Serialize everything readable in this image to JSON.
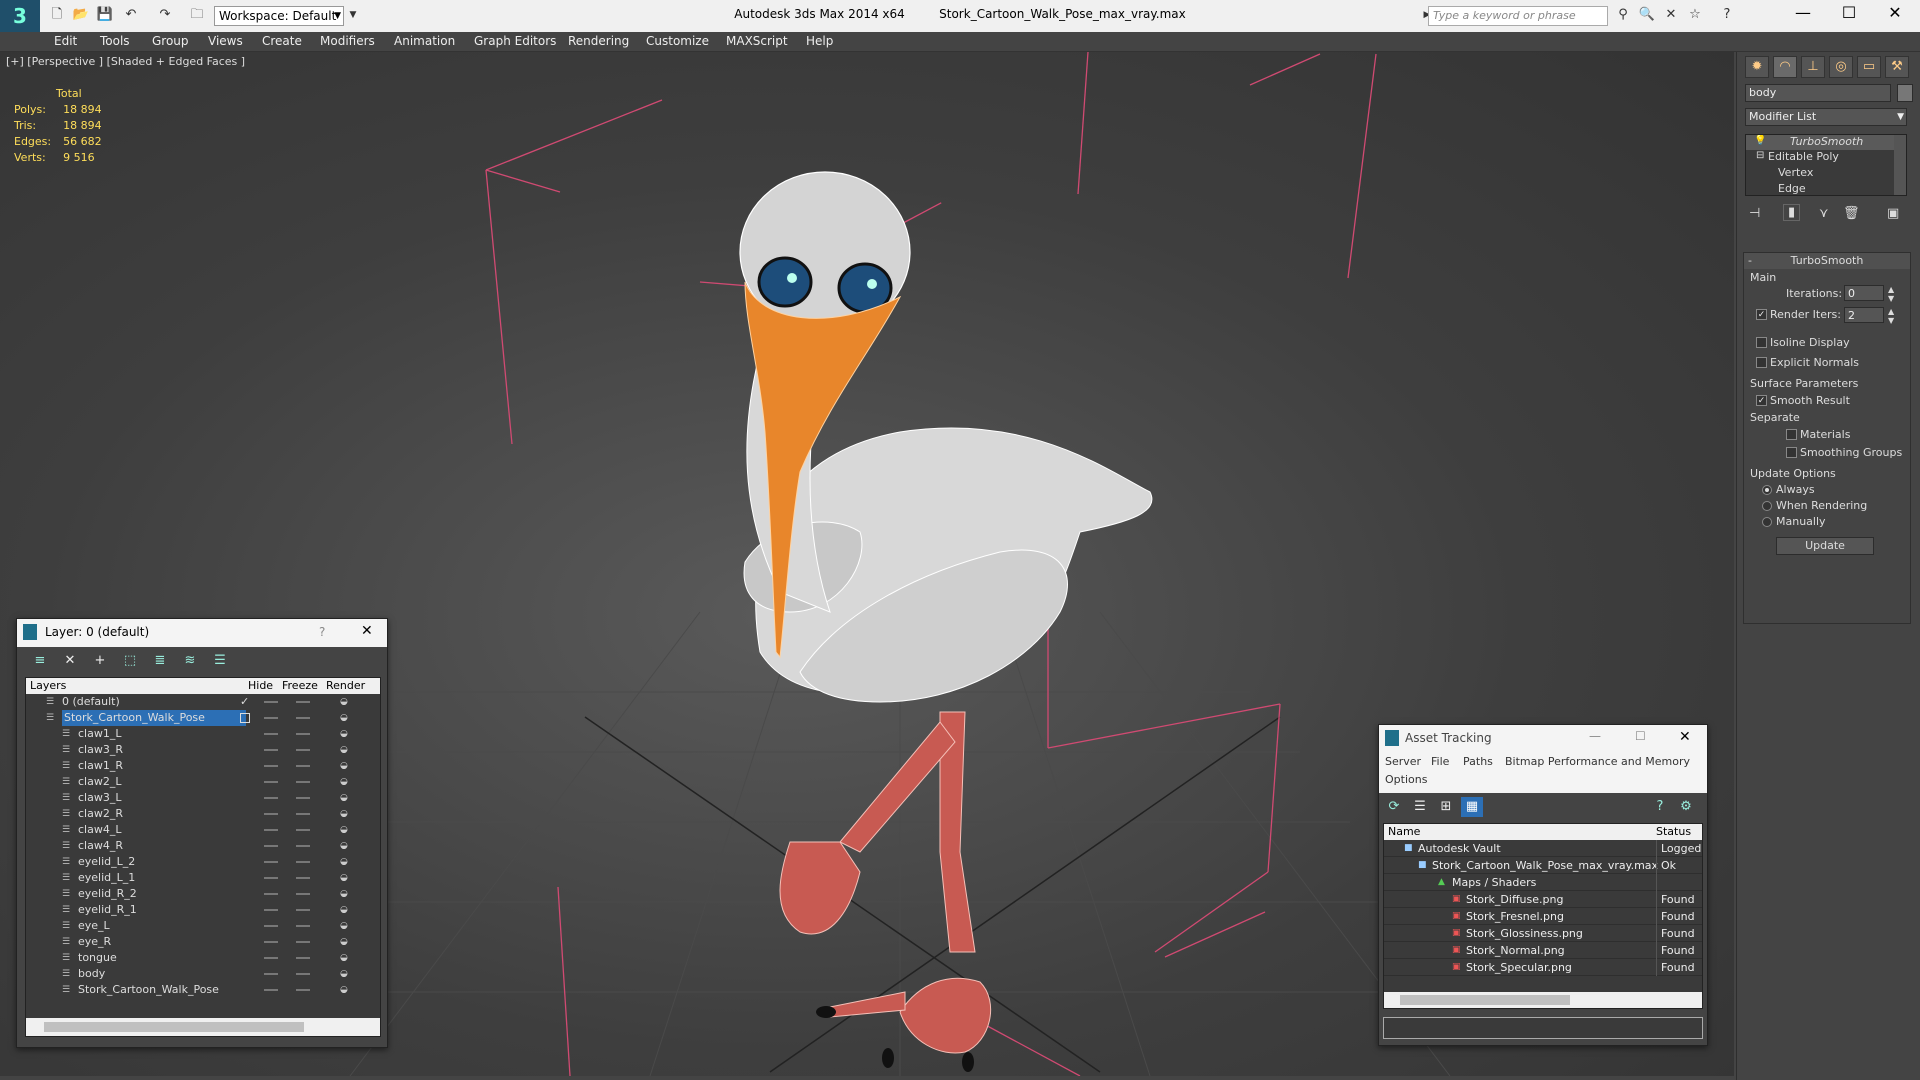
{
  "title": {
    "app": "Autodesk 3ds Max  2014 x64",
    "file": "Stork_Cartoon_Walk_Pose_max_vray.max"
  },
  "workspace": "Workspace: Default",
  "search_placeholder": "Type a keyword or phrase",
  "menu": [
    "Edit",
    "Tools",
    "Group",
    "Views",
    "Create",
    "Modifiers",
    "Animation",
    "Graph Editors",
    "Rendering",
    "Customize",
    "MAXScript",
    "Help"
  ],
  "viewport": {
    "label": "[+] [Perspective ] [Shaded + Edged Faces ]",
    "stats_header": "Total",
    "stats": [
      {
        "label": "Polys:",
        "value": "18 894"
      },
      {
        "label": "Tris:",
        "value": "18 894"
      },
      {
        "label": "Edges:",
        "value": "56 682"
      },
      {
        "label": "Verts:",
        "value": "9 516"
      }
    ]
  },
  "command_panel": {
    "object_name": "body",
    "modifier_list": "Modifier List",
    "stack": [
      "TurboSmooth",
      "Editable Poly",
      "Vertex",
      "Edge"
    ],
    "rollout_title": "TurboSmooth",
    "main_label": "Main",
    "iterations_label": "Iterations:",
    "iterations_value": "0",
    "render_iters_label": "Render Iters:",
    "render_iters_value": "2",
    "isoline": "Isoline Display",
    "explicit_normals": "Explicit Normals",
    "surface_params": "Surface Parameters",
    "smooth_result": "Smooth Result",
    "separate": "Separate",
    "materials": "Materials",
    "smoothing_groups": "Smoothing Groups",
    "update_options": "Update Options",
    "always": "Always",
    "when_rendering": "When Rendering",
    "manually": "Manually",
    "update_button": "Update"
  },
  "layer_panel": {
    "title": "Layer: 0 (default)",
    "help": "?",
    "columns": [
      "Layers",
      "Hide",
      "Freeze",
      "Render"
    ],
    "layers": [
      {
        "name": "0 (default)",
        "level": 0,
        "checked": true
      },
      {
        "name": "Stork_Cartoon_Walk_Pose",
        "level": 0,
        "selected": true
      },
      {
        "name": "claw1_L",
        "level": 1
      },
      {
        "name": "claw3_R",
        "level": 1
      },
      {
        "name": "claw1_R",
        "level": 1
      },
      {
        "name": "claw2_L",
        "level": 1
      },
      {
        "name": "claw3_L",
        "level": 1
      },
      {
        "name": "claw2_R",
        "level": 1
      },
      {
        "name": "claw4_L",
        "level": 1
      },
      {
        "name": "claw4_R",
        "level": 1
      },
      {
        "name": "eyelid_L_2",
        "level": 1
      },
      {
        "name": "eyelid_L_1",
        "level": 1
      },
      {
        "name": "eyelid_R_2",
        "level": 1
      },
      {
        "name": "eyelid_R_1",
        "level": 1
      },
      {
        "name": "eye_L",
        "level": 1
      },
      {
        "name": "eye_R",
        "level": 1
      },
      {
        "name": "tongue",
        "level": 1
      },
      {
        "name": "body",
        "level": 1
      },
      {
        "name": "Stork_Cartoon_Walk_Pose",
        "level": 1
      }
    ]
  },
  "asset_panel": {
    "title": "Asset Tracking",
    "menu": [
      "Server",
      "File",
      "Paths",
      "Bitmap Performance and Memory",
      "Options"
    ],
    "columns": [
      "Name",
      "Status"
    ],
    "rows": [
      {
        "name": "Autodesk Vault",
        "status": "Logged",
        "level": 0
      },
      {
        "name": "Stork_Cartoon_Walk_Pose_max_vray.max",
        "status": "Ok",
        "level": 1
      },
      {
        "name": "Maps / Shaders",
        "status": "",
        "level": 2
      },
      {
        "name": "Stork_Diffuse.png",
        "status": "Found",
        "level": 3
      },
      {
        "name": "Stork_Fresnel.png",
        "status": "Found",
        "level": 3
      },
      {
        "name": "Stork_Glossiness.png",
        "status": "Found",
        "level": 3
      },
      {
        "name": "Stork_Normal.png",
        "status": "Found",
        "level": 3
      },
      {
        "name": "Stork_Specular.png",
        "status": "Found",
        "level": 3
      }
    ]
  }
}
